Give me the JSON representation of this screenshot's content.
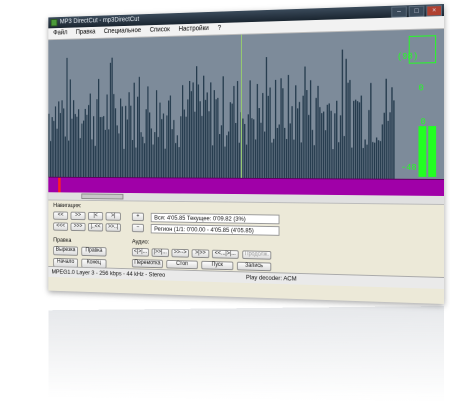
{
  "window": {
    "title": "MP3 DirectCut - mp3DirectCut"
  },
  "menu": [
    "Файл",
    "Правка",
    "Специальное",
    "Список",
    "Настройки",
    "?"
  ],
  "meter": {
    "db_top": "(98)",
    "db_zero": "0",
    "db_mid": "0",
    "db_low": "-48",
    "level_left": 0.85,
    "level_right": 0.85
  },
  "navigation": {
    "title": "Навигация:",
    "row1": [
      "<<",
      ">>",
      "|<",
      ">|"
    ],
    "row2": [
      "<<<",
      ">>>",
      "|..<<",
      ">>..|"
    ],
    "plus": "+",
    "minus": "−"
  },
  "info": {
    "total": "Вся: 4'05.85   Текущее: 0'09.82  (3%)",
    "region": "Регион (1/1: 0'00.00 - 4'05.85 (4'05.85)"
  },
  "edit": {
    "title": "Правка",
    "cut": "Вырезка",
    "paste": "Правка",
    "start": "Начало",
    "end": "Конец"
  },
  "audio": {
    "title": "Аудио:",
    "row1": [
      "<|>|...",
      "|>>|...",
      ">>-->",
      ">|>>",
      "<<...|>|...",
      "Продолж."
    ],
    "row2": [
      "Перемотка",
      "Стоп",
      "Пуск",
      "Запись"
    ]
  },
  "status": {
    "left": "MPEG1.0 Layer 3 - 256 kbps - 44 kHz - Stereo",
    "right": "Play decoder: ACM"
  }
}
